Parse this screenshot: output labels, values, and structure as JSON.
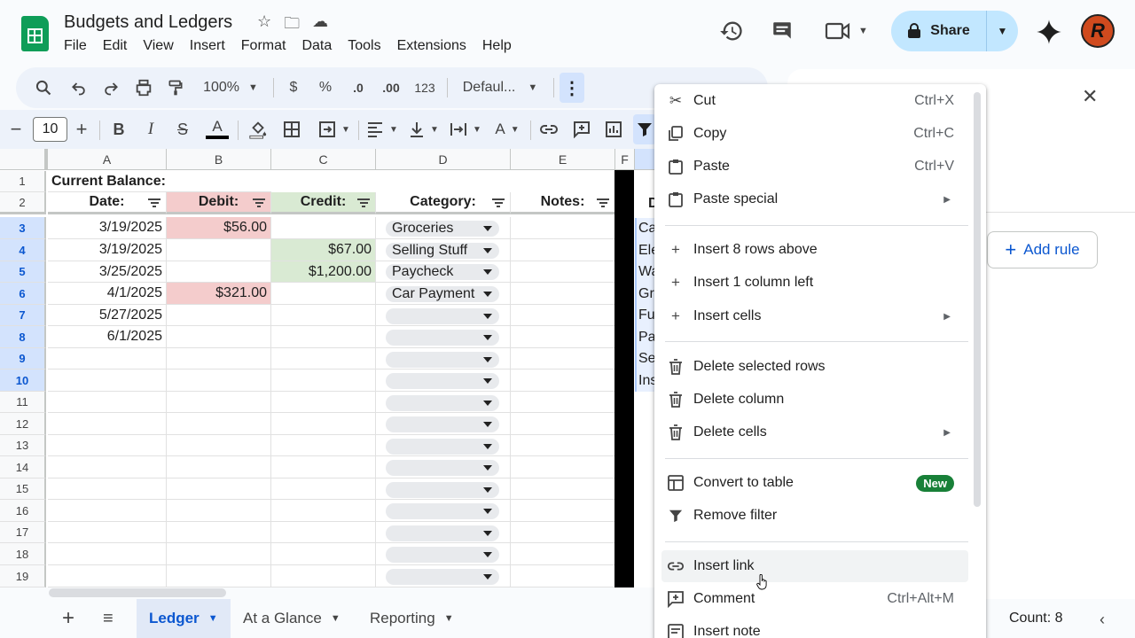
{
  "app": {
    "title": "Budgets and Ledgers",
    "menu": [
      "File",
      "Edit",
      "View",
      "Insert",
      "Format",
      "Data",
      "Tools",
      "Extensions",
      "Help"
    ],
    "share_label": "Share",
    "avatar_letter": "R"
  },
  "toolbar": {
    "zoom": "100%",
    "currency": "$",
    "percent": "%",
    "dec_decrease": ".0",
    "dec_increase": ".00",
    "number_format": "123",
    "font": "Defaul...",
    "font_size": "10"
  },
  "columns": [
    "A",
    "B",
    "C",
    "D",
    "E",
    "F"
  ],
  "rows": [
    "1",
    "2",
    "3",
    "4",
    "5",
    "6",
    "7",
    "8",
    "9",
    "10",
    "11",
    "12",
    "13",
    "14",
    "15",
    "16",
    "17",
    "18",
    "19"
  ],
  "sheet": {
    "balance_label": "Current Balance:",
    "headers": {
      "date": "Date:",
      "debit": "Debit:",
      "credit": "Credit:",
      "category": "Category:",
      "notes": "Notes:",
      "g": "D"
    },
    "entries": [
      {
        "date": "3/19/2025",
        "debit": "$56.00",
        "credit": "",
        "category": "Groceries",
        "g": "Ca"
      },
      {
        "date": "3/19/2025",
        "debit": "",
        "credit": "$67.00",
        "category": "Selling Stuff",
        "g": "Ele"
      },
      {
        "date": "3/25/2025",
        "debit": "",
        "credit": "$1,200.00",
        "category": "Paycheck",
        "g": "Wa"
      },
      {
        "date": "4/1/2025",
        "debit": "$321.00",
        "credit": "",
        "category": "Car Payment",
        "g": "Gro"
      },
      {
        "date": "5/27/2025",
        "debit": "",
        "credit": "",
        "category": "",
        "g": "Fu"
      },
      {
        "date": "6/1/2025",
        "debit": "",
        "credit": "",
        "category": "",
        "g": "Pa"
      },
      {
        "date": "",
        "debit": "",
        "credit": "",
        "category": "",
        "g": "Se"
      },
      {
        "date": "",
        "debit": "",
        "credit": "",
        "category": "",
        "g": "Ins"
      }
    ]
  },
  "context_menu": {
    "cut": {
      "label": "Cut",
      "shortcut": "Ctrl+X"
    },
    "copy": {
      "label": "Copy",
      "shortcut": "Ctrl+C"
    },
    "paste": {
      "label": "Paste",
      "shortcut": "Ctrl+V"
    },
    "paste_special": {
      "label": "Paste special"
    },
    "insert_rows_above": {
      "label": "Insert 8 rows above"
    },
    "insert_column_left": {
      "label": "Insert 1 column left"
    },
    "insert_cells": {
      "label": "Insert cells"
    },
    "delete_rows": {
      "label": "Delete selected rows"
    },
    "delete_column": {
      "label": "Delete column"
    },
    "delete_cells": {
      "label": "Delete cells"
    },
    "convert_table": {
      "label": "Convert to table",
      "badge": "New"
    },
    "remove_filter": {
      "label": "Remove filter"
    },
    "insert_link": {
      "label": "Insert link"
    },
    "comment": {
      "label": "Comment",
      "shortcut": "Ctrl+Alt+M"
    },
    "insert_note": {
      "label": "Insert note"
    }
  },
  "side_panel": {
    "add_rule": "Add rule"
  },
  "sheet_tabs": [
    "Ledger",
    "At a Glance",
    "Reporting"
  ],
  "status": {
    "count": "Count: 8"
  },
  "colors": {
    "accent": "#0b57d0",
    "share_bg": "#c2e7ff",
    "debit_bg": "#f4cccc",
    "credit_bg": "#d9ead3",
    "new_badge": "#188038"
  }
}
